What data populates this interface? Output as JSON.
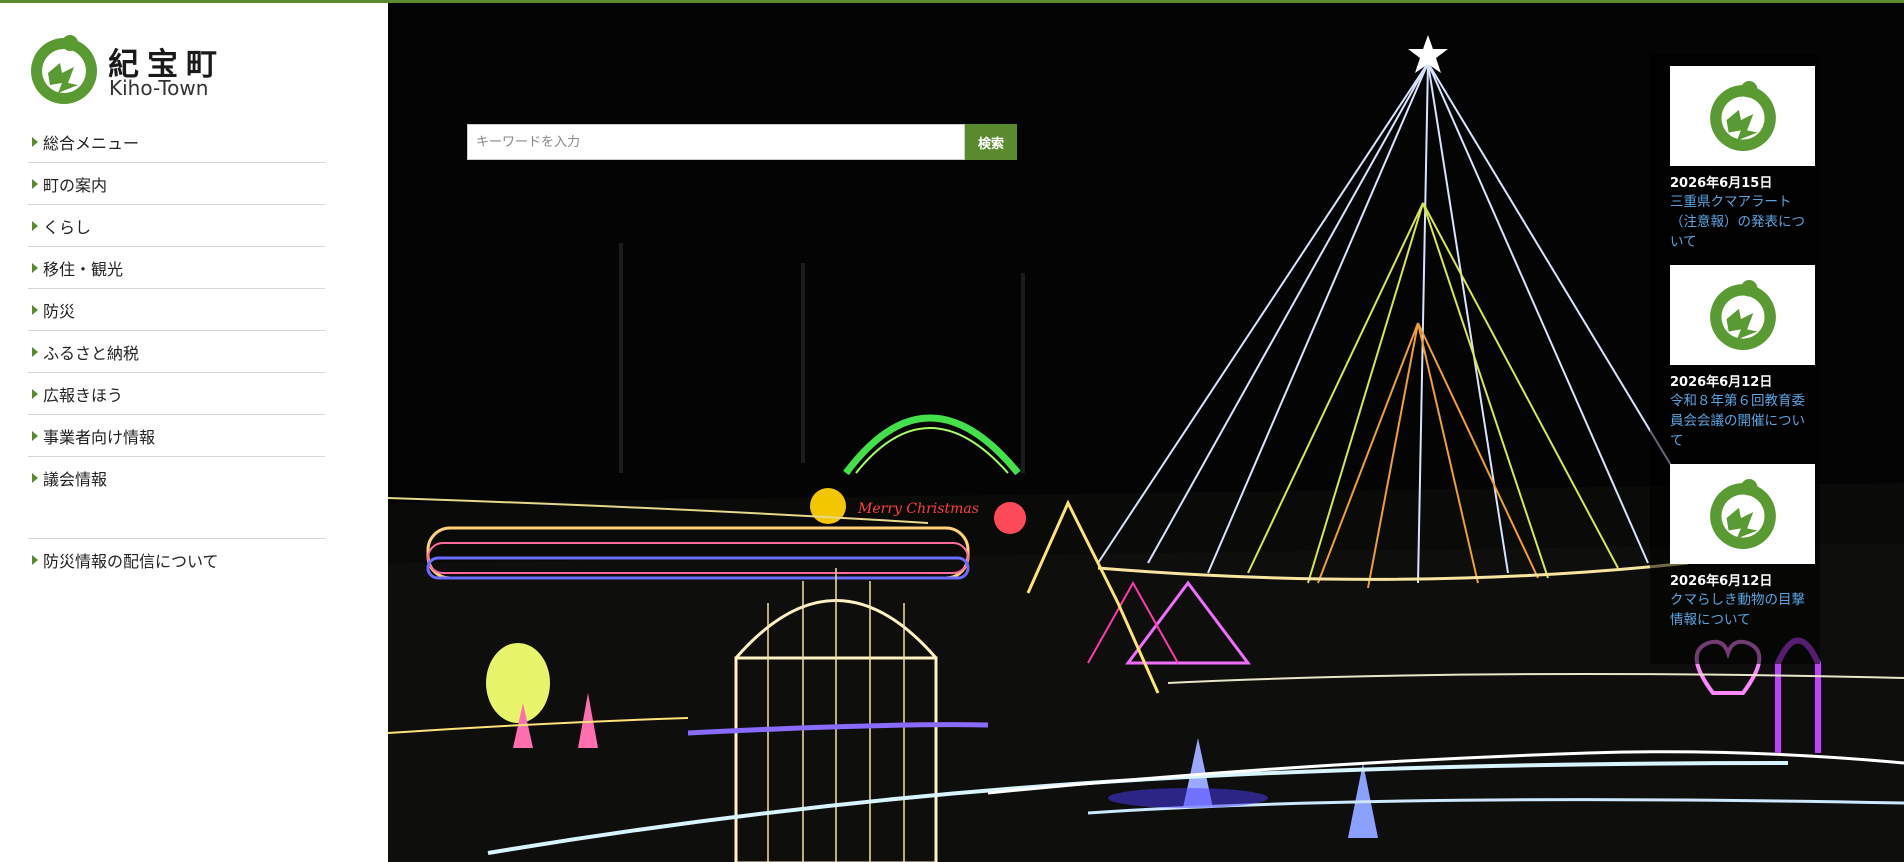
{
  "site": {
    "name_jp": "紀宝町",
    "name_en": "Kiho-Town",
    "accent_color": "#5a8a2e",
    "logo_icon": "kiho-town-logo-icon"
  },
  "nav": {
    "items": [
      {
        "label": "総合メニュー"
      },
      {
        "label": "町の案内"
      },
      {
        "label": "くらし"
      },
      {
        "label": "移住・観光"
      },
      {
        "label": "防災"
      },
      {
        "label": "ふるさと納税"
      },
      {
        "label": "広報きほう"
      },
      {
        "label": "事業者向け情報"
      },
      {
        "label": "議会情報"
      }
    ],
    "secondary": [
      {
        "label": "防災情報の配信について"
      }
    ]
  },
  "search": {
    "placeholder": "キーワードを入力",
    "button_label": "検索"
  },
  "hero": {
    "sign_text": "Merry Christmas"
  },
  "news": {
    "items": [
      {
        "date": "2026年6月15日",
        "title": "三重県クマアラート（注意報）の発表について"
      },
      {
        "date": "2026年6月12日",
        "title": "令和８年第６回教育委員会会議の開催について"
      },
      {
        "date": "2026年6月12日",
        "title": "クマらしき動物の目撃情報について"
      }
    ]
  }
}
